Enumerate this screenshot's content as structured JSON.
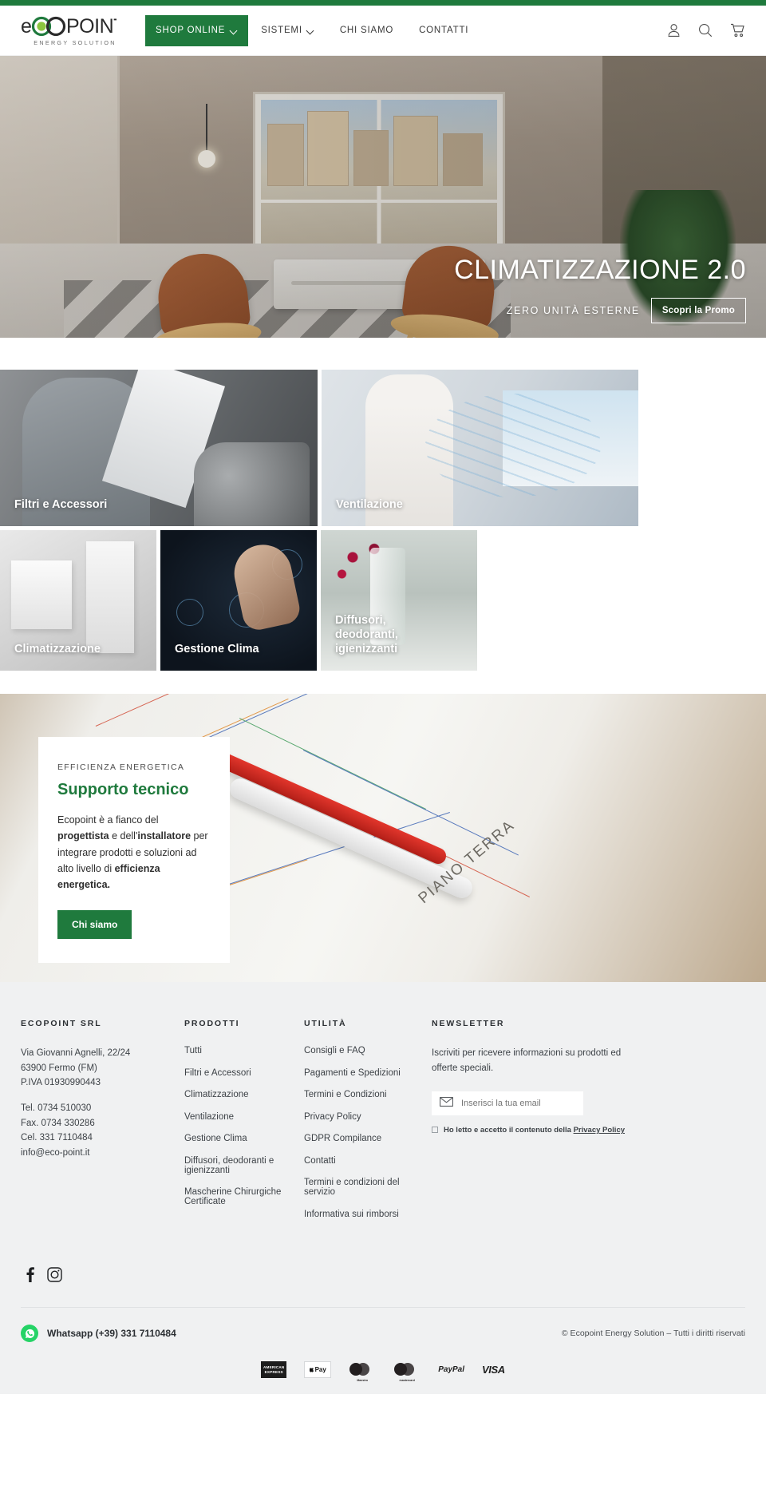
{
  "brand": {
    "logo_text": "ECOPOINT",
    "logo_tagline": "ENERGY SOLUTION",
    "accent_green": "#1f7a3d",
    "logo_dot_green": "#8cc63f"
  },
  "header": {
    "shop_label": "SHOP ONLINE",
    "nav": [
      {
        "label": "SISTEMI",
        "has_caret": true
      },
      {
        "label": "CHI SIAMO",
        "has_caret": false
      },
      {
        "label": "CONTATTI",
        "has_caret": false
      }
    ],
    "icons": [
      {
        "name": "account-icon",
        "title": "Account"
      },
      {
        "name": "search-icon",
        "title": "Cerca"
      },
      {
        "name": "cart-icon",
        "title": "Carrello"
      }
    ]
  },
  "hero": {
    "title": "CLIMATIZZAZIONE 2.0",
    "subtitle": "ZERO UNITÀ ESTERNE",
    "cta": "Scopri la Promo"
  },
  "tiles": [
    {
      "label": "Filtri e Accessori"
    },
    {
      "label": "Ventilazione"
    },
    {
      "label": "Climatizzazione"
    },
    {
      "label": "Gestione Clima"
    },
    {
      "label": "Diffusori, deodoranti, igienizzanti"
    }
  ],
  "support": {
    "kicker": "EFFICIENZA ENERGETICA",
    "heading": "Supporto tecnico",
    "body_1": "Ecopoint è a fianco del ",
    "body_b1": "progettista",
    "body_2": " e dell'",
    "body_b2": "installatore",
    "body_3": " per integrare prodotti e soluzioni ad alto livello di ",
    "body_b3": "efficienza energetica.",
    "cta": "Chi siamo",
    "blueprint_label": "PIANO TERRA"
  },
  "footer": {
    "company": {
      "heading": "ECOPOINT SRL",
      "address_1": "Via Giovanni Agnelli, 22/24",
      "address_2": "63900 Fermo (FM)",
      "address_3": "P.IVA 01930990443",
      "tel": "Tel. 0734 510030",
      "fax": "Fax. 0734 330286",
      "cel": "Cel. 331 7110484",
      "email": "info@eco-point.it"
    },
    "products": {
      "heading": "PRODOTTI",
      "links": [
        "Tutti",
        "Filtri e Accessori",
        "Climatizzazione",
        "Ventilazione",
        "Gestione Clima",
        "Diffusori, deodoranti e igienizzanti",
        "Mascherine Chirurgiche Certificate"
      ]
    },
    "utility": {
      "heading": "UTILITÀ",
      "links": [
        "Consigli e FAQ",
        "Pagamenti e Spedizioni",
        "Termini e Condizioni",
        "Privacy Policy",
        "GDPR Compilance",
        "Contatti",
        "Termini e condizioni del servizio",
        "Informativa sui rimborsi"
      ]
    },
    "newsletter": {
      "heading": "NEWSLETTER",
      "text": "Iscriviti per ricevere informazioni su prodotti ed offerte speciali.",
      "placeholder": "Inserisci la tua email",
      "value": "",
      "consent_prefix": "Ho letto e accetto il contenuto della ",
      "consent_link": "Privacy Policy"
    },
    "social": [
      {
        "name": "facebook-icon",
        "label": "Facebook"
      },
      {
        "name": "instagram-icon",
        "label": "Instagram"
      }
    ],
    "whatsapp": "Whatsapp (+39) 331 7110484",
    "copyright": "© Ecopoint Energy Solution – Tutti i diritti riservati",
    "payments": [
      {
        "name": "amex-card-icon",
        "label": "AMERICAN EXPRESS"
      },
      {
        "name": "apple-pay-icon",
        "label": "Pay"
      },
      {
        "name": "maestro-card-icon",
        "label": "Maestro"
      },
      {
        "name": "mastercard-card-icon",
        "label": "mastercard"
      },
      {
        "name": "paypal-icon",
        "label": "PayPal"
      },
      {
        "name": "visa-card-icon",
        "label": "VISA"
      }
    ]
  }
}
